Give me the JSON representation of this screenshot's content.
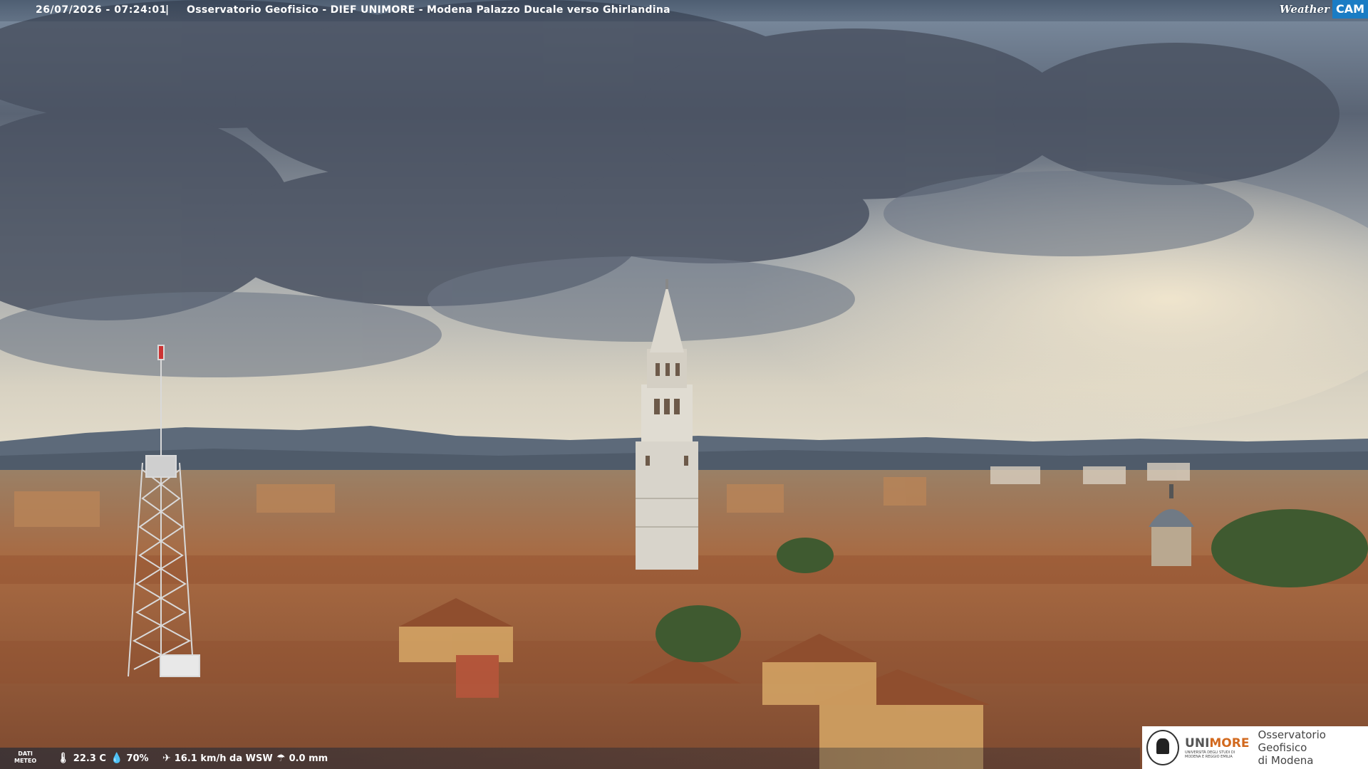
{
  "overlay": {
    "timestamp": "26/07/2026 - 07:24:01",
    "separator": "|",
    "camera_title": "Osservatorio Geofisico - DIEF UNIMORE - Modena Palazzo Ducale verso Ghirlandina",
    "logo_weather": "Weather",
    "logo_cam": "CAM"
  },
  "weather": {
    "label_line1": "DATI",
    "label_line2": "METEO",
    "temperature": "22.3 C",
    "humidity": "70%",
    "wind": "16.1 km/h da WSW",
    "rain": "0.0 mm"
  },
  "badge": {
    "uni_prefix": "UNI",
    "uni_suffix": "MORE",
    "uni_sub": "UNIVERSITÀ DEGLI STUDI DI MODENA E REGGIO EMILIA",
    "observatory_line1": "Osservatorio Geofisico",
    "observatory_line2": "di Modena"
  },
  "colors": {
    "sky_dark": "#4e5868",
    "sky_light": "#d9d2c0",
    "mountains": "#5d6a7a",
    "roofs": "#a15a37",
    "walls": "#c99a5c",
    "tower": "#d8d4cb",
    "cam_blue": "#1a7cc4"
  }
}
